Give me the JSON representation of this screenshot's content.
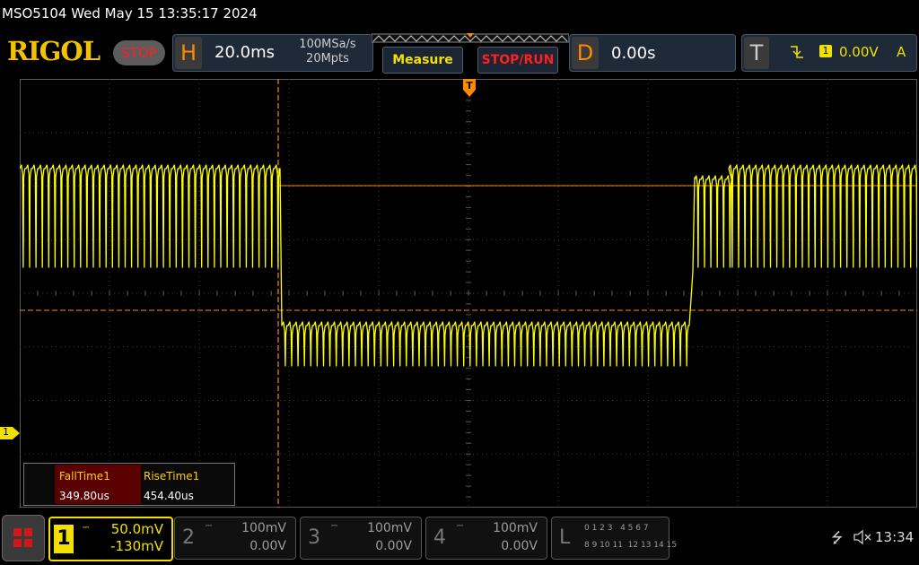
{
  "title_bar": {
    "text": "MSO5104  Wed May 15 13:35:17 2024"
  },
  "brand": {
    "logo": "RIGOL",
    "status": "STOP"
  },
  "horizontal": {
    "letter": "H",
    "timebase": "20.0ms",
    "sample_rate": "100MSa/s",
    "memory_depth": "20Mpts"
  },
  "buttons": {
    "measure": "Measure",
    "stop_run": "STOP/RUN"
  },
  "delay": {
    "letter": "D",
    "value": "0.00s"
  },
  "trigger": {
    "letter": "T",
    "edge_icon": "falling-edge-icon",
    "channel": "1",
    "level": "0.00V",
    "mode": "A"
  },
  "measurements": {
    "fall_label": "FallTime1",
    "fall_value": "349.80us",
    "rise_label": "RiseTime1",
    "rise_value": "454.40us"
  },
  "ground_marker": {
    "label": "1"
  },
  "trigger_marker": {
    "label": "T"
  },
  "channels": [
    {
      "number": "1",
      "scale": "50.0mV",
      "offset": "-130mV",
      "color": "#ffff00"
    },
    {
      "number": "2",
      "scale": "100mV",
      "offset": "0.00V",
      "color": "#888888"
    },
    {
      "number": "3",
      "scale": "100mV",
      "offset": "0.00V",
      "color": "#888888"
    },
    {
      "number": "4",
      "scale": "100mV",
      "offset": "0.00V",
      "color": "#888888"
    }
  ],
  "logic": {
    "letter": "L",
    "row1": "0 1 2 3   4 5 6 7",
    "row2": "8 9 10 11  12 13 14 15"
  },
  "status_bar": {
    "clock": "13:34"
  },
  "colors": {
    "trace": "#ffff00",
    "cursor": "#ff8a00",
    "background": "#000000"
  }
}
